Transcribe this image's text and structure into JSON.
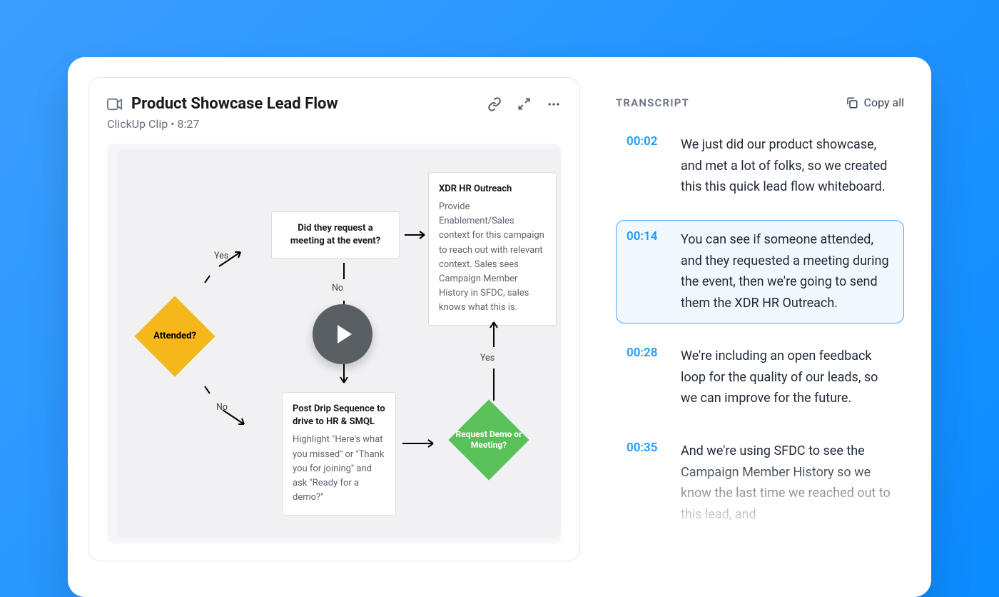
{
  "clip": {
    "title": "Product Showcase Lead Flow",
    "source": "ClickUp Clip",
    "duration": "8:27"
  },
  "whiteboard": {
    "attended": "Attended?",
    "requestMeeting": "Did they request a meeting at the event?",
    "xdr": {
      "title": "XDR HR Outreach",
      "body": "Provide Enablement/Sales context for this campaign to reach out with relevant context. Sales sees Campaign Member History in SFDC, sales knows what this is."
    },
    "postDrip": {
      "title": "Post Drip Sequence to drive to HR & SMQL",
      "body": "Highlight \"Here's what you missed\" or \"Thank you for joining\" and ask \"Ready for a demo?\""
    },
    "requestDemo": "Request Demo or Meeting?",
    "yes": "Yes",
    "no": "No"
  },
  "transcript": {
    "label": "TRANSCRIPT",
    "copy": "Copy all",
    "items": [
      {
        "time": "00:02",
        "text": "We just did our product showcase, and met a lot of folks, so we created this this quick lead flow whiteboard.",
        "active": false
      },
      {
        "time": "00:14",
        "text": "You can see if someone attended, and they requested a meeting during the event, then we're going to send them the XDR HR Outreach.",
        "active": true
      },
      {
        "time": "00:28",
        "text": "We're including an open feedback loop for the quality of our leads, so we can improve for the future.",
        "active": false
      },
      {
        "time": "00:35",
        "text": "And we're using SFDC to see the Campaign Member History so we know the last time we reached out to this lead, and",
        "active": false,
        "faded": true
      }
    ]
  }
}
